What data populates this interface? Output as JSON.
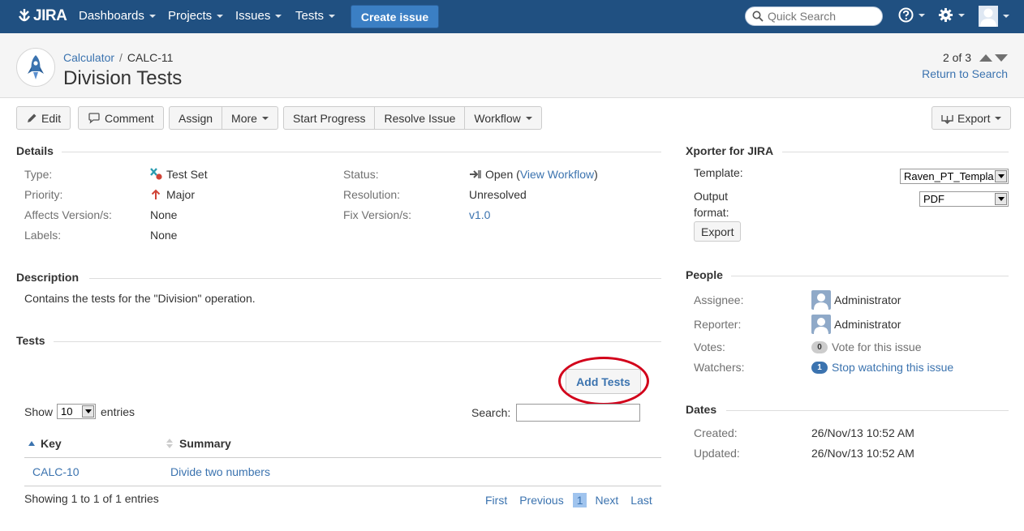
{
  "topbar": {
    "logo_text": "JIRA",
    "nav": [
      "Dashboards",
      "Projects",
      "Issues",
      "Tests"
    ],
    "create_label": "Create issue",
    "search_placeholder": "Quick Search",
    "icons": [
      "help-icon",
      "gear-icon",
      "user-avatar-icon"
    ]
  },
  "header": {
    "project": "Calculator",
    "issue_key": "CALC-11",
    "title": "Division Tests",
    "pager": "2 of 3",
    "return_label": "Return to Search"
  },
  "toolbar": {
    "edit": "Edit",
    "comment": "Comment",
    "assign": "Assign",
    "more": "More",
    "start_progress": "Start Progress",
    "resolve": "Resolve Issue",
    "workflow": "Workflow",
    "export": "Export"
  },
  "details": {
    "heading": "Details",
    "type_label": "Type:",
    "type_value": "Test Set",
    "priority_label": "Priority:",
    "priority_value": "Major",
    "affects_label": "Affects Version/s:",
    "affects_value": "None",
    "labels_label": "Labels:",
    "labels_value": "None",
    "status_label": "Status:",
    "status_value": "Open",
    "status_paren_open": "(",
    "view_workflow": "View Workflow",
    "status_paren_close": ")",
    "resolution_label": "Resolution:",
    "resolution_value": "Unresolved",
    "fix_label": "Fix Version/s:",
    "fix_value": "v1.0"
  },
  "description": {
    "heading": "Description",
    "text": "Contains the tests for the \"Division\" operation."
  },
  "tests": {
    "heading": "Tests",
    "add_label": "Add Tests",
    "show_label": "Show",
    "entries_value": "10",
    "entries_label": "entries",
    "search_label": "Search:",
    "col_key": "Key",
    "col_summary": "Summary",
    "rows": [
      {
        "key": "CALC-10",
        "summary": "Divide two numbers"
      }
    ],
    "showing": "Showing 1 to 1 of 1 entries",
    "pagination": {
      "first": "First",
      "previous": "Previous",
      "current": "1",
      "next": "Next",
      "last": "Last"
    }
  },
  "xporter": {
    "heading": "Xporter for JIRA",
    "template_label": "Template:",
    "template_value": "Raven_PT_Templa",
    "output_label_1": "Output",
    "output_label_2": "format:",
    "output_value": "PDF",
    "export_label": "Export"
  },
  "people": {
    "heading": "People",
    "assignee_label": "Assignee:",
    "assignee_value": "Administrator",
    "reporter_label": "Reporter:",
    "reporter_value": "Administrator",
    "votes_label": "Votes:",
    "votes_count": "0",
    "votes_text": "Vote for this issue",
    "watchers_label": "Watchers:",
    "watchers_count": "1",
    "watchers_text": "Stop watching this issue"
  },
  "dates": {
    "heading": "Dates",
    "created_label": "Created:",
    "created_value": "26/Nov/13 10:52 AM",
    "updated_label": "Updated:",
    "updated_value": "26/Nov/13 10:52 AM"
  },
  "colors": {
    "topbar": "#205081",
    "link": "#3b73af",
    "create": "#3b7fc4",
    "annotation": "#d2001a",
    "priority": "#d04437"
  }
}
